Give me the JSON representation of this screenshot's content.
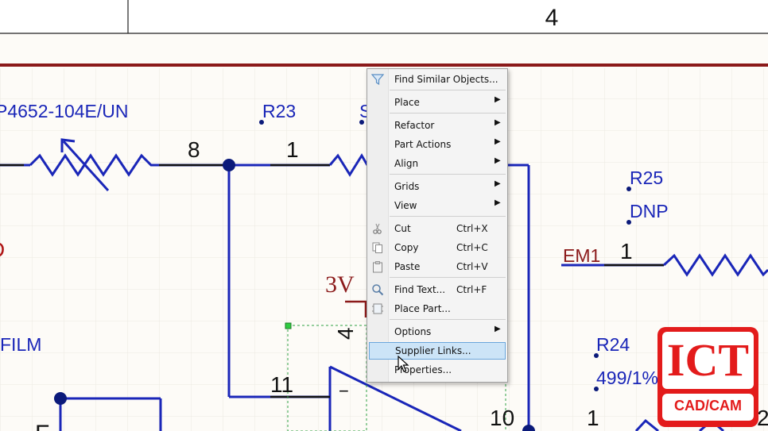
{
  "schematic": {
    "zone_number": "4",
    "labels": {
      "part_top_left": "P4652-104E/UN",
      "r23": "R23",
      "r23_partial": "S",
      "pin8": "8",
      "pin1_top": "1",
      "r25": "R25",
      "dnp": "DNP",
      "em1": "EM1",
      "pin1_right": "1",
      "red_left": "D",
      "voltage": "3V",
      "film": "FILM",
      "pin4": "4",
      "pin11": "11",
      "minus": "−",
      "r24": "R24",
      "r24_value": "499/1%/0603",
      "pin10": "10",
      "pin1_bottom": "1",
      "pin2_partial": "2",
      "bottom_partial": "F"
    }
  },
  "context_menu": {
    "items": [
      {
        "label": "Find Similar Objects...",
        "shortcut": "",
        "submenu": false,
        "icon": "filter-icon"
      },
      {
        "label": "Place",
        "shortcut": "",
        "submenu": true
      },
      {
        "label": "Refactor",
        "shortcut": "",
        "submenu": true
      },
      {
        "label": "Part Actions",
        "shortcut": "",
        "submenu": true
      },
      {
        "label": "Align",
        "shortcut": "",
        "submenu": true
      },
      {
        "label": "Grids",
        "shortcut": "",
        "submenu": true
      },
      {
        "label": "View",
        "shortcut": "",
        "submenu": true
      },
      {
        "label": "Cut",
        "shortcut": "Ctrl+X",
        "submenu": false,
        "icon": "scissors-icon"
      },
      {
        "label": "Copy",
        "shortcut": "Ctrl+C",
        "submenu": false,
        "icon": "copy-icon"
      },
      {
        "label": "Paste",
        "shortcut": "Ctrl+V",
        "submenu": false,
        "icon": "paste-icon"
      },
      {
        "label": "Find Text...",
        "shortcut": "Ctrl+F",
        "submenu": false,
        "icon": "magnifier-icon"
      },
      {
        "label": "Place Part...",
        "shortcut": "",
        "submenu": false,
        "icon": "place-part-icon"
      },
      {
        "label": "Options",
        "shortcut": "",
        "submenu": true
      },
      {
        "label": "Supplier Links...",
        "shortcut": "",
        "submenu": false,
        "highlighted": true
      },
      {
        "label": "Properties...",
        "shortcut": "",
        "submenu": false
      }
    ],
    "submenu_arrow": "▶"
  },
  "logo": {
    "title": "ICT",
    "subtitle": "CAD/CAM",
    "color": "#e31b1b"
  },
  "colors": {
    "wire": "#1a26b8",
    "border": "#8b0000",
    "background": "#fdfbf7",
    "grid": "#ece8e2",
    "highlight": "#cce4f7"
  }
}
